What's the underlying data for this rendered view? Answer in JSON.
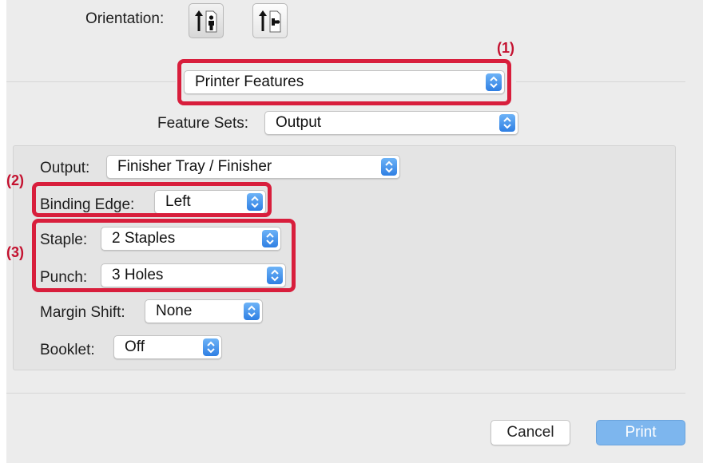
{
  "orientation": {
    "label": "Orientation:",
    "options": [
      "portrait-icon",
      "landscape-icon"
    ]
  },
  "section_popup": {
    "value": "Printer Features"
  },
  "feature_sets": {
    "label": "Feature Sets:",
    "value": "Output"
  },
  "output": {
    "label": "Output:",
    "value": "Finisher Tray / Finisher"
  },
  "binding_edge": {
    "label": "Binding Edge:",
    "value": "Left"
  },
  "staple": {
    "label": "Staple:",
    "value": "2 Staples"
  },
  "punch": {
    "label": "Punch:",
    "value": "3 Holes"
  },
  "margin_shift": {
    "label": "Margin Shift:",
    "value": "None"
  },
  "booklet": {
    "label": "Booklet:",
    "value": "Off"
  },
  "callouts": {
    "one": "(1)",
    "two": "(2)",
    "three": "(3)"
  },
  "buttons": {
    "cancel": "Cancel",
    "print": "Print"
  },
  "colors": {
    "highlight": "#d81e3c",
    "accent": "#2f7fe3",
    "print_button": "#7db6ee"
  }
}
